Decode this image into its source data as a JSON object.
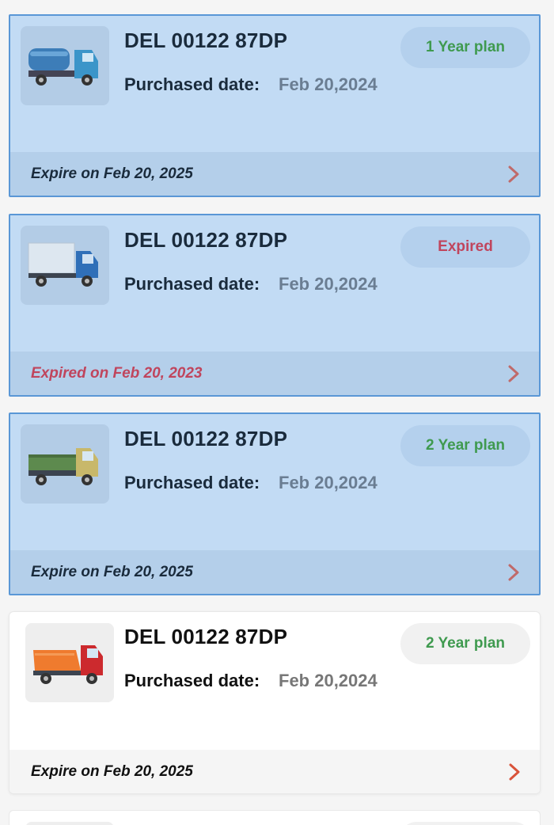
{
  "colors": {
    "plan_green": "#3f9a4f",
    "expired_red": "#c0455d",
    "chevron_selected": "#c06a6a",
    "chevron_plain": "#d9533a"
  },
  "cards": [
    {
      "registration": "DEL 00122 87DP",
      "purchased_label": "Purchased date:",
      "purchased_date": "Feb 20,2024",
      "badge": "1 Year plan",
      "badge_status": "plan",
      "footer": "Expire on Feb 20, 2025",
      "footer_status": "normal",
      "truck_icon": "tanker-truck-icon",
      "selected": true
    },
    {
      "registration": "DEL 00122 87DP",
      "purchased_label": "Purchased date:",
      "purchased_date": "Feb 20,2024",
      "badge": "Expired",
      "badge_status": "expired",
      "footer": "Expired on Feb 20, 2023",
      "footer_status": "expired",
      "truck_icon": "box-truck-icon",
      "selected": true
    },
    {
      "registration": "DEL 00122 87DP",
      "purchased_label": "Purchased date:",
      "purchased_date": "Feb 20,2024",
      "badge": "2 Year plan",
      "badge_status": "plan",
      "footer": "Expire on Feb 20, 2025",
      "footer_status": "normal",
      "truck_icon": "flatbed-truck-icon",
      "selected": true
    },
    {
      "registration": "DEL 00122 87DP",
      "purchased_label": "Purchased date:",
      "purchased_date": "Feb 20,2024",
      "badge": "2 Year plan",
      "badge_status": "plan",
      "footer": "Expire on Feb 20, 2025",
      "footer_status": "normal",
      "truck_icon": "dump-truck-icon",
      "selected": false
    }
  ]
}
